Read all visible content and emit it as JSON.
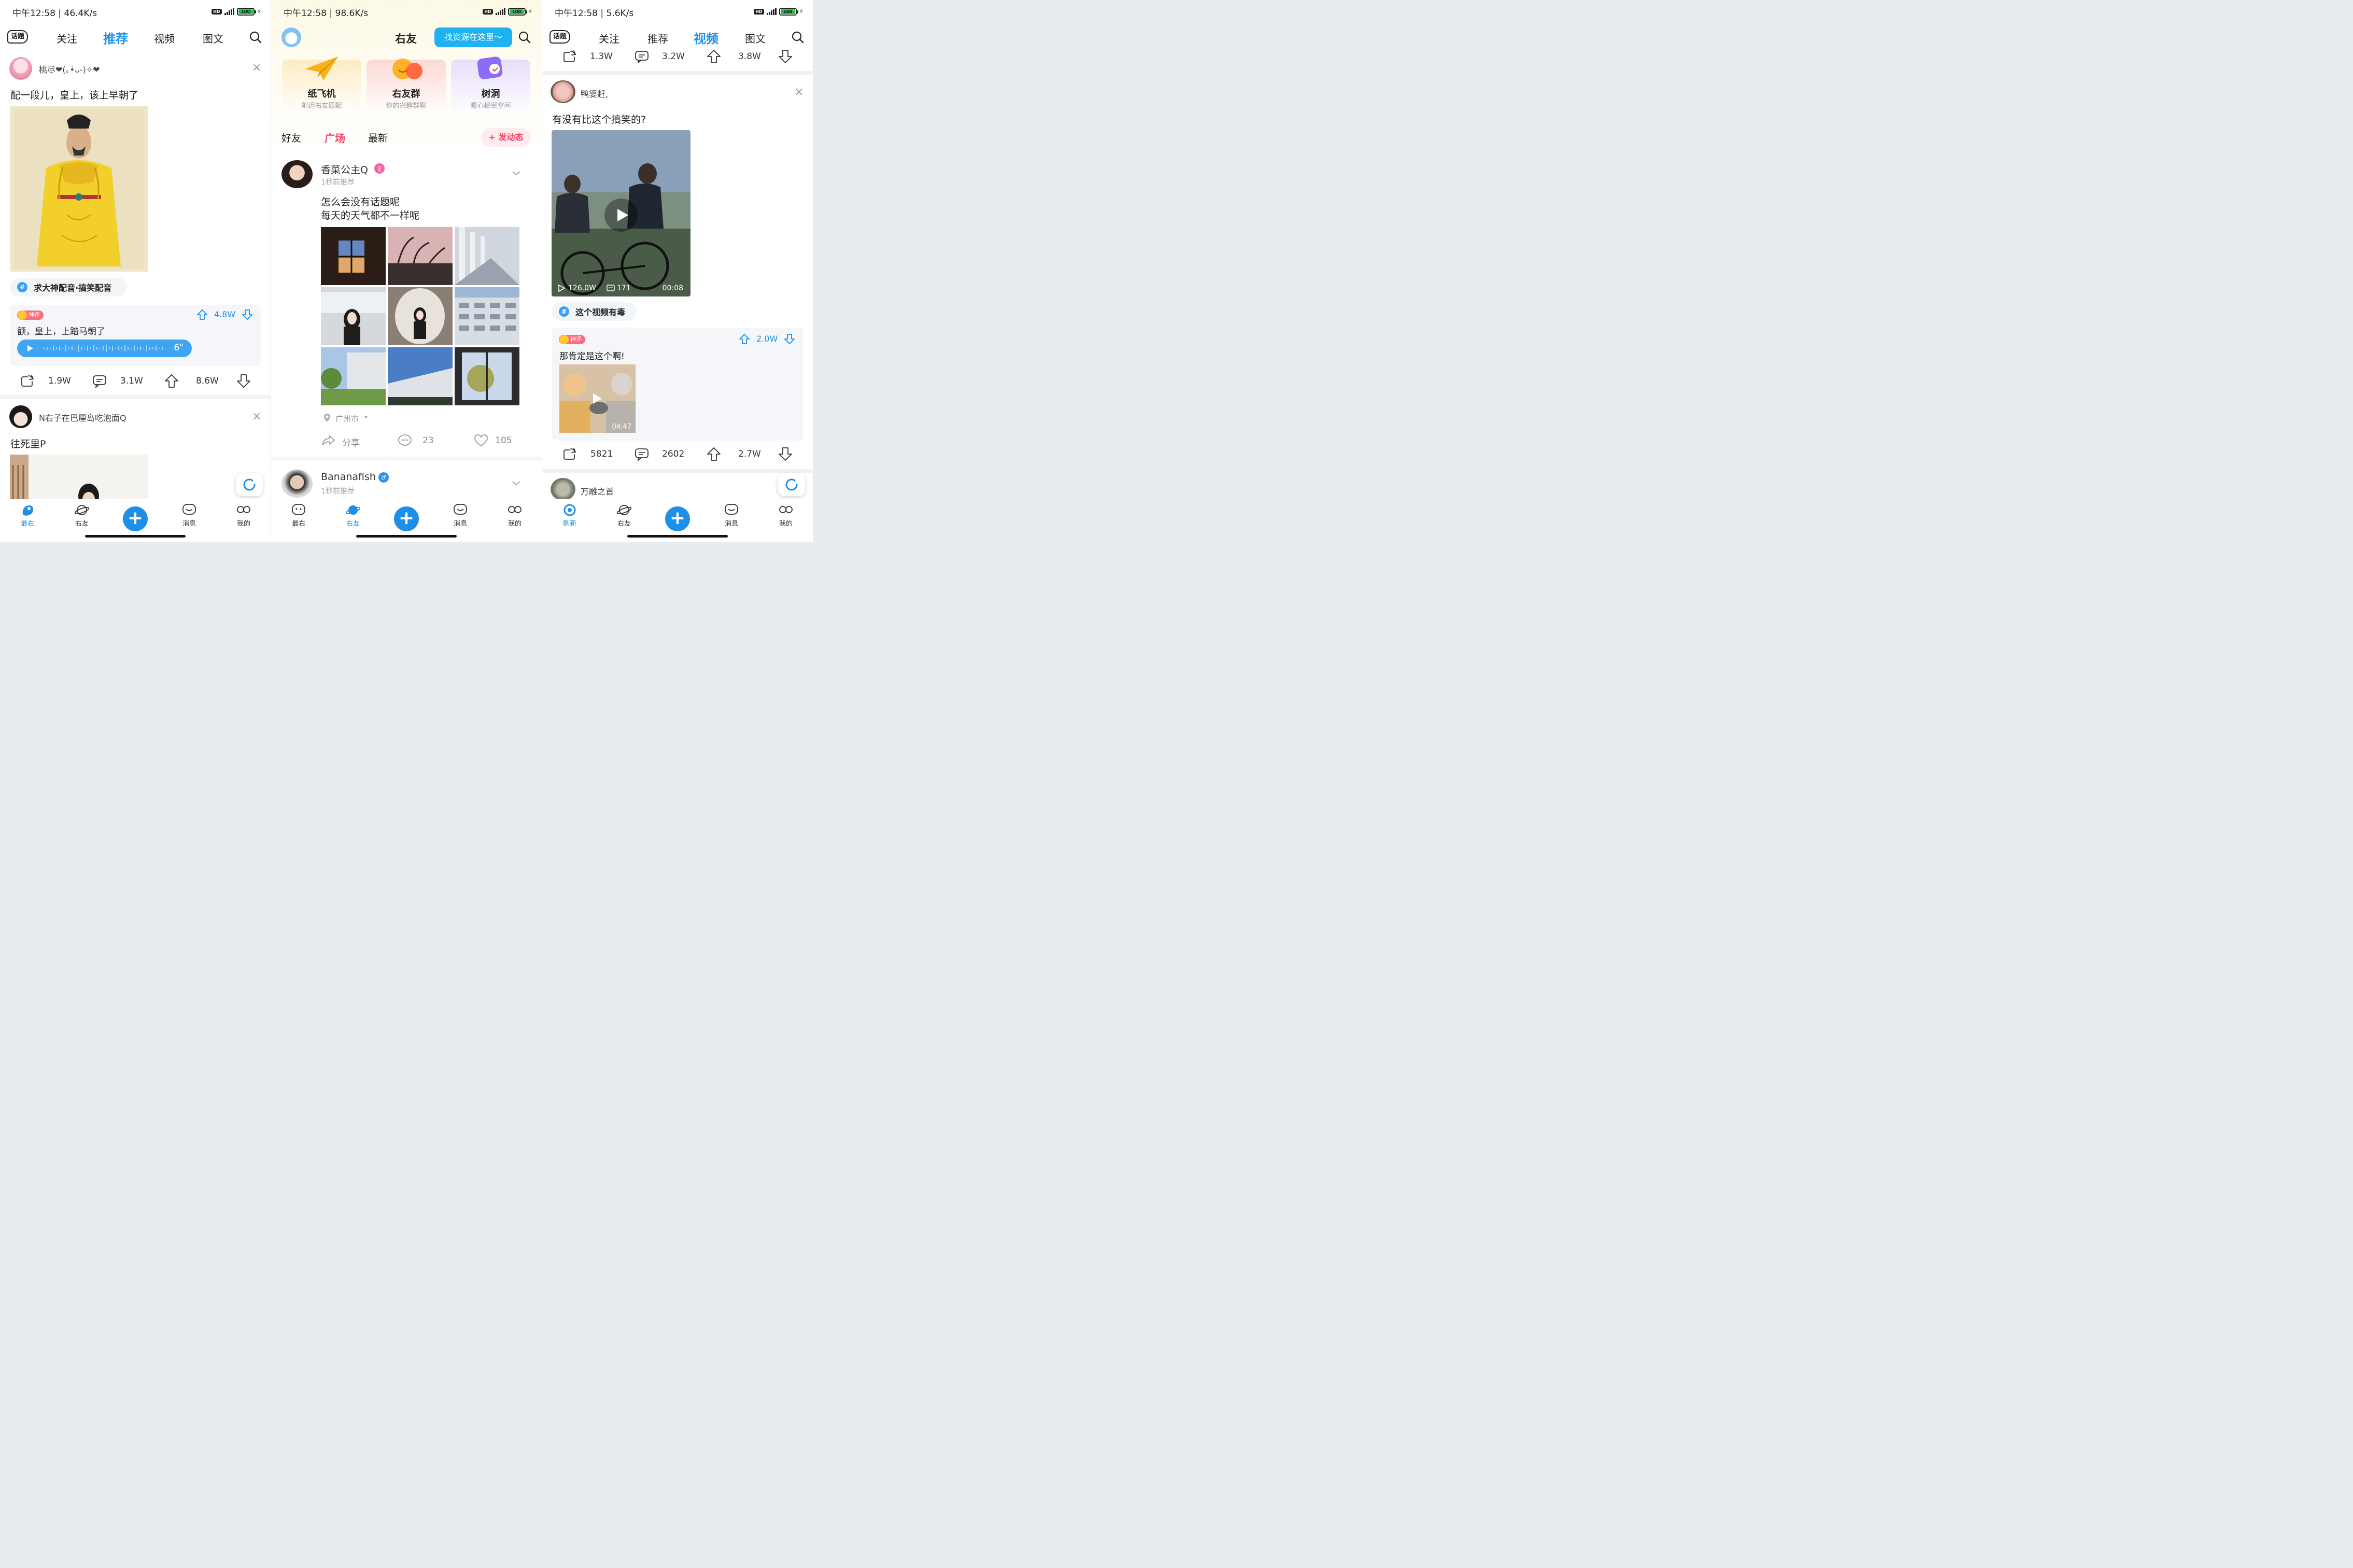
{
  "screen1": {
    "status": {
      "time": "中午12:58 | 46.4K/s",
      "battery": "100"
    },
    "tabs": {
      "topic": "话题",
      "follow": "关注",
      "recommend": "推荐",
      "video": "视频",
      "imagetext": "图文"
    },
    "post1": {
      "user": "桃尽❤(｡•̀ᴗ-)✧❤",
      "text": "配一段儿，皇上，该上早朝了",
      "tag": "求大神配音·搞笑配音",
      "god_badge": "神评",
      "god_likes": "4.8W",
      "god_text": "额，皇上，上踏马朝了",
      "voice_duration": "6\"",
      "shares": "1.9W",
      "comments": "3.1W",
      "likes": "8.6W"
    },
    "post2": {
      "user": "N右子在巴厘岛吃泡面Q",
      "text": "往死里P"
    },
    "nav": {
      "n1": "最右",
      "n2": "右友",
      "n3": "消息",
      "n4": "我的"
    }
  },
  "screen2": {
    "status": {
      "time": "中午12:58 | 98.6K/s",
      "battery": "100"
    },
    "title": "右友",
    "find_btn": "找资源在这里～",
    "cards": [
      {
        "title": "纸飞机",
        "sub": "附近右友匹配",
        "color": "#fdebc2"
      },
      {
        "title": "右友群",
        "sub": "你的兴趣群聊",
        "color": "#fcd9d3"
      },
      {
        "title": "树洞",
        "sub": "暖心秘密空间",
        "color": "#e8defa"
      }
    ],
    "subtabs": {
      "friends": "好友",
      "square": "广场",
      "latest": "最新",
      "post": "+ 发动态"
    },
    "post1": {
      "user": "香菜公主Q",
      "meta": "1秒前推荐",
      "line1": "怎么会没有话题呢",
      "line2": "每天的天气都不一样呢",
      "location": "广州市",
      "share": "分享",
      "comments": "23",
      "likes": "105"
    },
    "post2": {
      "user": "Bananafish",
      "meta": "1秒前推荐"
    },
    "nav": {
      "n1": "最右",
      "n2": "右友",
      "n3": "消息",
      "n4": "我的"
    }
  },
  "screen3": {
    "status": {
      "time": "中午12:58 | 5.6K/s",
      "battery": "100"
    },
    "tabs": {
      "topic": "话题",
      "follow": "关注",
      "recommend": "推荐",
      "video": "视频",
      "imagetext": "图文"
    },
    "top_stats": {
      "shares": "1.3W",
      "comments": "3.2W",
      "likes": "3.8W"
    },
    "post1": {
      "user": "鸭婆赶,",
      "text": "有没有比这个搞笑的?",
      "video_views": "126.0W",
      "video_comments": "171",
      "video_duration": "00:08",
      "tag": "这个视频有毒",
      "god_badge": "神评",
      "god_likes": "2.0W",
      "god_text": "那肯定是这个啊!",
      "god_video_duration": "04:47",
      "shares": "5821",
      "comments": "2602",
      "likes": "2.7W"
    },
    "post2": {
      "user": "万雕之首"
    },
    "nav": {
      "n1": "刷新",
      "n2": "右友",
      "n3": "消息",
      "n4": "我的"
    }
  },
  "colors": {
    "accent": "#1e8fe8",
    "pink": "#ff4d6d",
    "god_badge": "#ff6b81"
  }
}
